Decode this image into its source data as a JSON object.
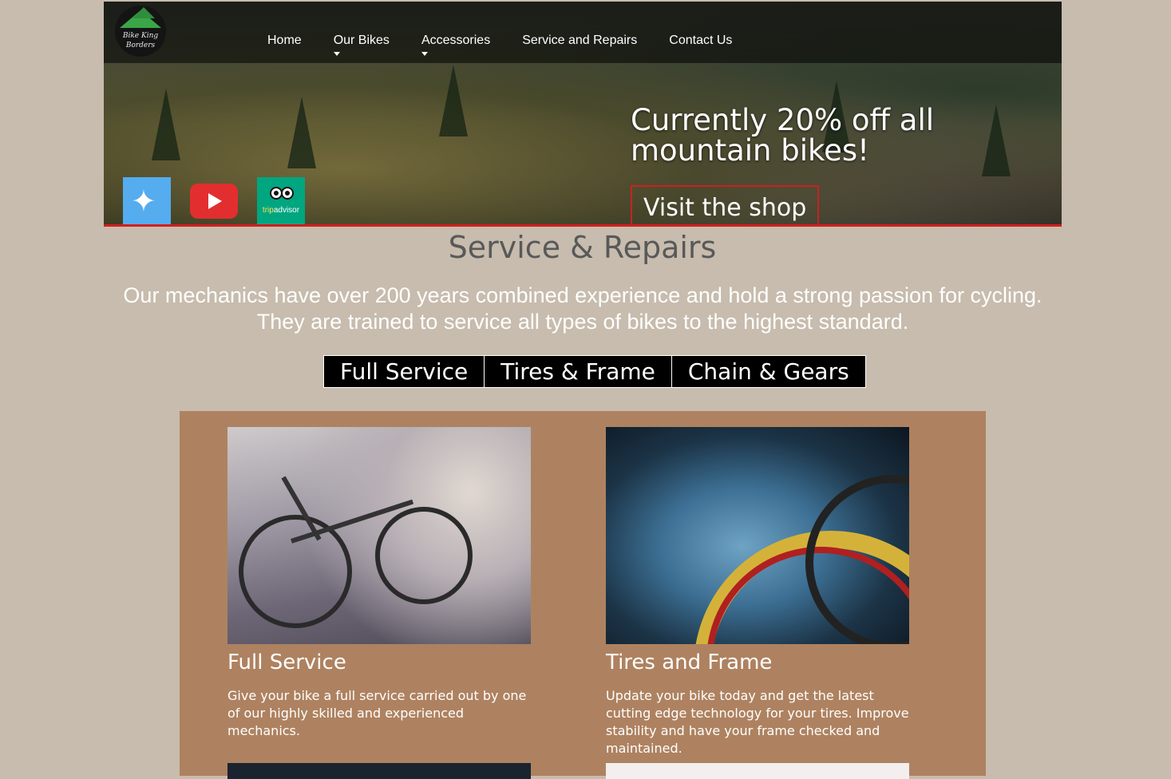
{
  "logo": {
    "line1": "Bike King",
    "line2": "Borders"
  },
  "nav": {
    "items": [
      {
        "label": "Home",
        "has_dropdown": false
      },
      {
        "label": "Our Bikes",
        "has_dropdown": true
      },
      {
        "label": "Accessories",
        "has_dropdown": true
      },
      {
        "label": "Service and Repairs",
        "has_dropdown": false
      },
      {
        "label": "Contact Us",
        "has_dropdown": false
      }
    ]
  },
  "hero": {
    "promo_line1": "Currently 20% off all",
    "promo_line2": "mountain bikes!",
    "cta_label": "Visit the shop",
    "accent_color": "#d21e1e"
  },
  "social": {
    "twitter": {
      "icon": "twitter-icon",
      "color": "#55acee"
    },
    "youtube": {
      "icon": "youtube-icon",
      "color": "#e22e2e"
    },
    "tripadvisor": {
      "icon": "tripadvisor-icon",
      "color": "#00a680",
      "label_trip": "trip",
      "label_advisor": "advisor"
    }
  },
  "page": {
    "title": "Service & Repairs",
    "intro": "Our mechanics have over 200 years combined experience and hold a strong passion for cycling. They are trained to service all types of bikes to the highest standard."
  },
  "tabs": [
    {
      "label": "Full Service"
    },
    {
      "label": "Tires & Frame"
    },
    {
      "label": "Chain & Gears"
    }
  ],
  "cards": [
    {
      "title": "Full Service",
      "text": "Give your bike a full service carried out by one of our highly skilled and experienced mechanics."
    },
    {
      "title": "Tires and Frame",
      "text": "Update your bike today and get the latest cutting edge technology for your tires. Improve stability and have your frame checked and maintained."
    }
  ],
  "colors": {
    "background": "#c7bcad",
    "panel": "#ae8260",
    "tab_bg": "#000000"
  }
}
